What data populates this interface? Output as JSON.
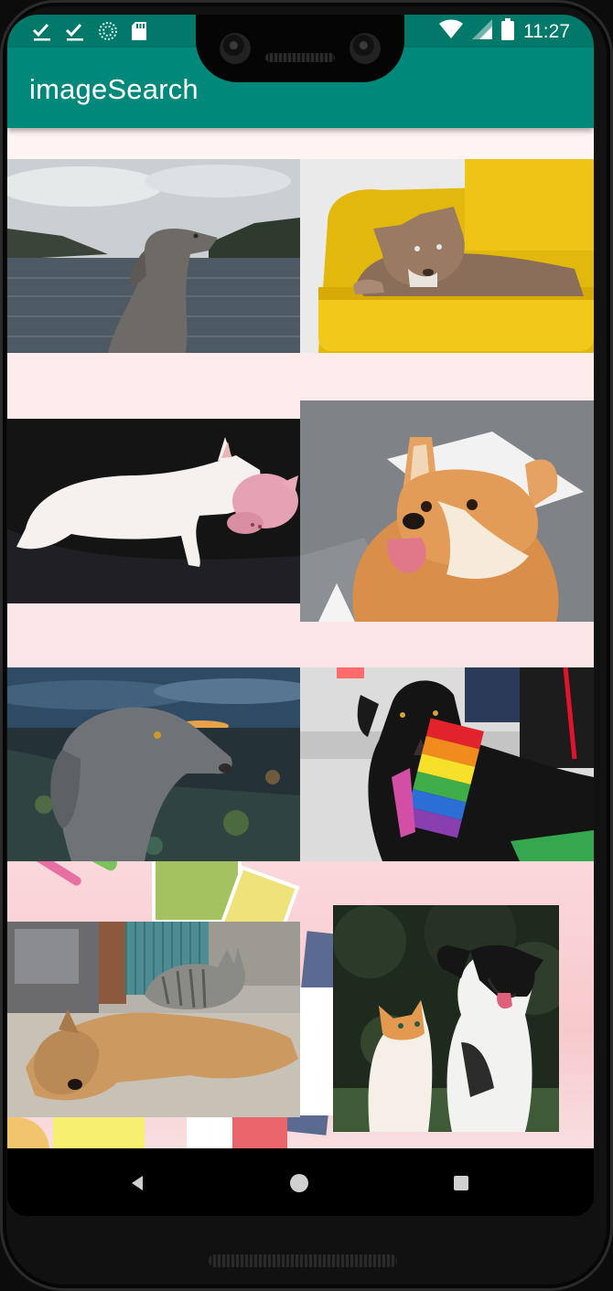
{
  "app": {
    "title": "imageSearch"
  },
  "status_bar": {
    "time": "11:27",
    "left_icons": [
      "check-icon",
      "check-icon",
      "sync-icon",
      "sd-card-icon"
    ],
    "right_icons": [
      "wifi-icon",
      "signal-icon",
      "battery-icon"
    ]
  },
  "accent_colors": {
    "status_bar": "#00796b",
    "app_bar": "#00897b"
  },
  "results": [
    {
      "subject": "weimaraner at lake",
      "icon": "photo-thumbnail"
    },
    {
      "subject": "dog on yellow armchair",
      "icon": "photo-thumbnail"
    },
    {
      "subject": "bull terrier with pink pig pillow",
      "icon": "photo-thumbnail"
    },
    {
      "subject": "corgi looking up",
      "icon": "photo-thumbnail"
    },
    {
      "subject": "weimaraner at sunset shore",
      "icon": "photo-thumbnail"
    },
    {
      "subject": "black dog with rainbow flag",
      "icon": "photo-thumbnail"
    },
    {
      "subject": "cat lying on sleeping dog",
      "icon": "photo-thumbnail"
    },
    {
      "subject": "kitten and puppy",
      "icon": "photo-thumbnail"
    }
  ],
  "nav_bar": {
    "buttons": [
      "back-icon",
      "home-icon",
      "recents-icon"
    ]
  }
}
